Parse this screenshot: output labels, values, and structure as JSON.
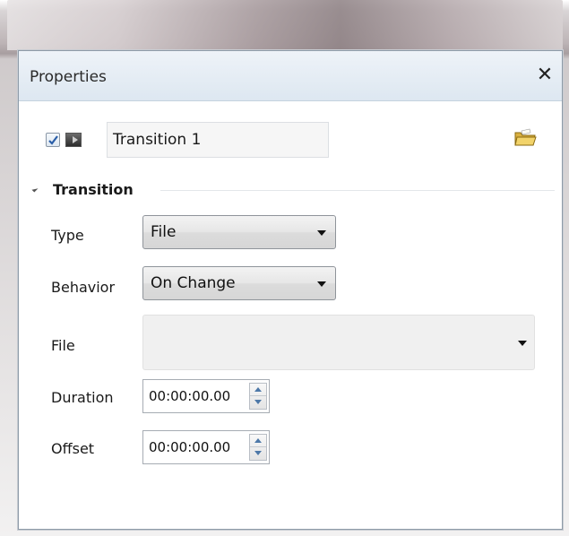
{
  "window": {
    "title": "Properties",
    "close_glyph": "✕"
  },
  "item": {
    "enabled": true,
    "name": "Transition 1",
    "type_icon": "media-clip-icon",
    "browse_icon": "folder-icon"
  },
  "section": {
    "label": "Transition",
    "expanded": true
  },
  "fields": {
    "type": {
      "label": "Type",
      "value": "File"
    },
    "behavior": {
      "label": "Behavior",
      "value": "On Change"
    },
    "file": {
      "label": "File",
      "value": ""
    },
    "duration": {
      "label": "Duration",
      "value": "00:00:00.00"
    },
    "offset": {
      "label": "Offset",
      "value": "00:00:00.00"
    }
  },
  "colors": {
    "titlebar": "#dde7f1",
    "check": "#2a5ea8",
    "spin_arrow": "#4d78a8"
  }
}
